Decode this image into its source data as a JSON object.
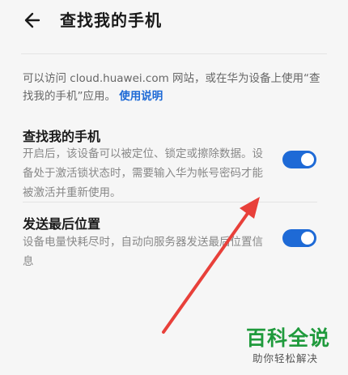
{
  "header": {
    "title": "查找我的手机"
  },
  "intro": {
    "text": "可以访问 cloud.huawei.com 网站，或在华为设备上使用“查找我的手机”应用。",
    "link": "使用说明"
  },
  "settings": [
    {
      "title": "查找我的手机",
      "description": "开启后，该设备可以被定位、锁定或擦除数据。设备处于激活锁状态时，需要输入华为帐号密码才能被激活并重新使用。",
      "enabled": true
    },
    {
      "title": "发送最后位置",
      "description": "设备电量快耗尽时，自动向服务器发送最后位置信息",
      "enabled": true
    }
  ],
  "watermark": {
    "main": "百科全说",
    "sub": "助你轻松解决"
  },
  "colors": {
    "accent": "#1e6ad6",
    "arrow": "#e8403a",
    "watermark": "#1f9a3c"
  }
}
